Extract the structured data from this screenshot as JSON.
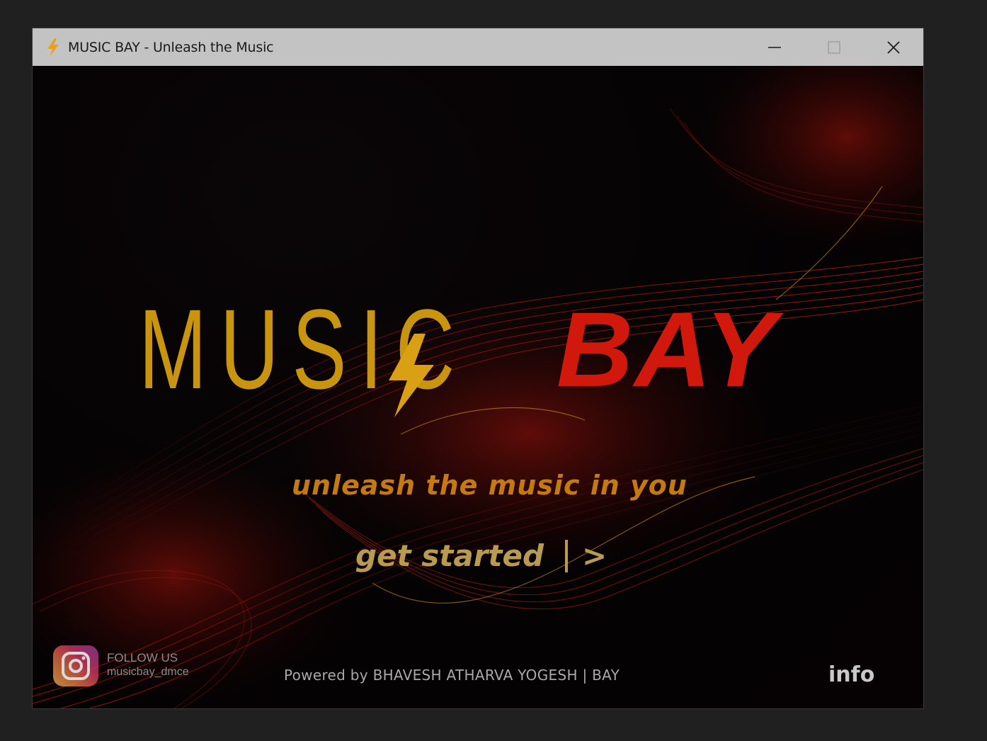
{
  "window": {
    "title": "MUSIC BAY - Unleash the Music",
    "controls": {
      "minimize_icon": "minimize-icon",
      "maximize_icon": "maximize-icon",
      "close_icon": "close-icon"
    }
  },
  "splash": {
    "logo_music": "MUSIC",
    "logo_bay": "BAY",
    "tagline": "unleash the music in you",
    "get_started_label": "get started",
    "get_started_arrow": ">",
    "social": {
      "icon": "instagram-icon",
      "follow_label": "FOLLOW US",
      "handle": "musicbay_dmce"
    },
    "powered_by": "Powered by BHAVESH ATHARVA YOGESH  |  BAY",
    "info_label": "info"
  },
  "colors": {
    "titlebar": "#c3c3c3",
    "background": "#050305",
    "logo_gold": "#c9950f",
    "logo_red": "#d1180c",
    "tagline": "#c57a10",
    "wave_red": "#c01a0a"
  }
}
